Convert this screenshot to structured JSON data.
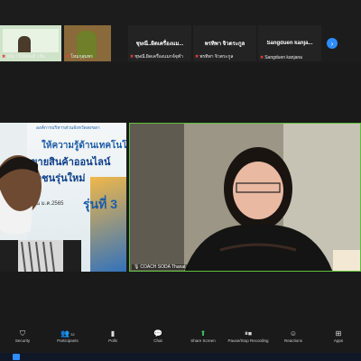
{
  "thumbnails": [
    {
      "label": "หนึ่ง / นิทัศพงศ์ 1ชื่อ"
    },
    {
      "label": "โหมกุสุมพร"
    },
    {
      "title": "ชุษณี..ผิดเครื่องแม...",
      "label": "ชุษณี.ผิดเครื่องแมกจ์จุฬา"
    },
    {
      "title": "พรทิพา จิวตระกูล",
      "label": "พรทิพา จิวตระกูล"
    },
    {
      "title": "Sangduen  kanja...",
      "label": "Sangduen kanjana"
    }
  ],
  "left_video": {
    "banner": [
      "องค์การบริหารส่วนจังหวัดสงขลา",
      "ให้ความรู้ด้านเทคโนโลยี",
      "ขายสินค้าออนไลน์",
      "ุวชนรุ่นใหม่",
      "น ม.ค.2565",
      "รุ่นที่ 3"
    ]
  },
  "right_video": {
    "label": "COACH SODA Thanat"
  },
  "toolbar": {
    "buttons": [
      {
        "icon": "security-icon",
        "label": "Security"
      },
      {
        "icon": "participants-icon",
        "label": "Participants",
        "count": "32"
      },
      {
        "icon": "polls-icon",
        "label": "Polls"
      },
      {
        "icon": "chat-icon",
        "label": "Chat"
      },
      {
        "icon": "share-screen-icon",
        "label": "Share Screen"
      },
      {
        "icon": "recording-icon",
        "label": "Pause/Stop Recording"
      },
      {
        "icon": "reactions-icon",
        "label": "Reactions"
      },
      {
        "icon": "apps-icon",
        "label": "Apps"
      }
    ]
  },
  "colors": {
    "active_speaker": "#5fbf3c",
    "accent": "#2d8cff",
    "muted": "#e0433a"
  }
}
